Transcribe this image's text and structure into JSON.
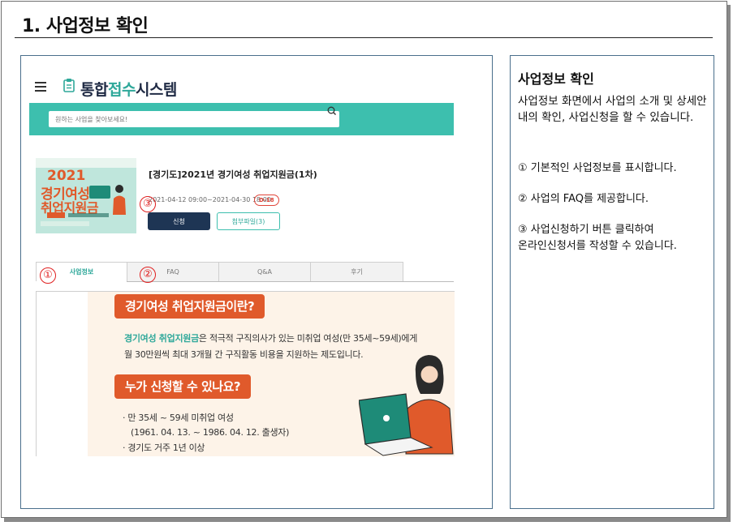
{
  "section_title": "1. 사업정보 확인",
  "app": {
    "logo_prefix": "통합",
    "logo_accent": "접수",
    "logo_suffix": "시스템",
    "search_placeholder": "원하는 사업을 찾아보세요!"
  },
  "poster": {
    "year": "2021",
    "line1": "경기여성",
    "line2": "취업지원금"
  },
  "business": {
    "title": "[경기도]2021년 경기여성 취업지원금(1차)",
    "period": "2021-04-12 09:00~2021-04-30 18:00",
    "dday": "D-18",
    "apply_label": "신청",
    "attach_label": "첨부파일(3)"
  },
  "tabs": [
    {
      "label": "사업정보",
      "active": true
    },
    {
      "label": "FAQ",
      "active": false
    },
    {
      "label": "Q&A",
      "active": false
    },
    {
      "label": "후기",
      "active": false
    }
  ],
  "markers": {
    "m1": "①",
    "m2": "②",
    "m3": "③"
  },
  "content": {
    "heading1": "경기여성 취업지원금이란?",
    "para_highlight": "경기여성 취업지원금",
    "para_rest1": "은 적극적 구직의사가 있는 미취업 여성(만 35세~59세)에게",
    "para_line2": "월 30만원씩 최대 3개월 간 구직활동 비용을 지원하는 제도입니다.",
    "heading2": "누가 신청할 수 있나요?",
    "list1": "· 만 35세 ~ 59세 미취업 여성",
    "list1_sub": "(1961. 04. 13. ~ 1986. 04. 12. 출생자)",
    "list2": "· 경기도 거주 1년 이상"
  },
  "right_panel": {
    "title": "사업정보 확인",
    "description": "사업정보 화면에서 사업의 소개 및 상세안내의 확인, 사업신청을 할 수 있습니다.",
    "items": [
      "① 기본적인 사업정보를 표시합니다.",
      "② 사업의 FAQ를 제공합니다.",
      "③ 사업신청하기  버튼 클릭하여",
      " 온라인신청서를 작성할 수 있습니다."
    ]
  },
  "colors": {
    "teal": "#3dbfae",
    "navy": "#1e3554",
    "orange": "#e05a2b",
    "marker_red": "#e02020"
  }
}
